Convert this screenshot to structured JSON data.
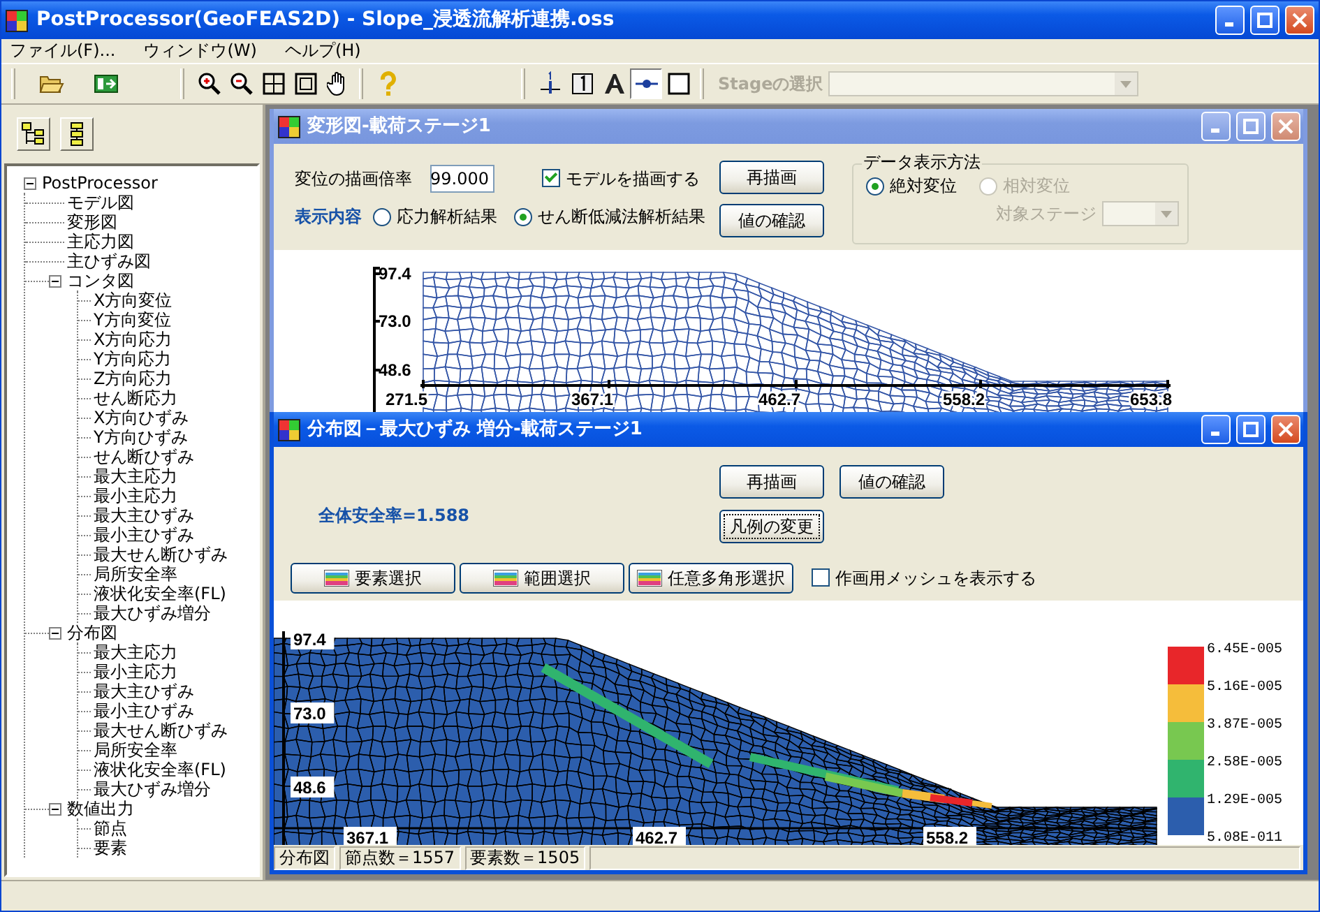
{
  "window": {
    "title": "PostProcessor(GeoFEAS2D) - Slope_浸透流解析連携.oss"
  },
  "menu": [
    "ファイル(F)...",
    "ウィンドウ(W)",
    "ヘルプ(H)"
  ],
  "toolbar": {
    "display_toggles": [
      {
        "pressed": false
      },
      {
        "pressed": false
      },
      {
        "pressed": false
      },
      {
        "pressed": true
      },
      {
        "pressed": false
      }
    ],
    "stage_select": {
      "label": "Stageの選択",
      "disabled": true
    }
  },
  "sidebar": {
    "tree": [
      {
        "label": "PostProcessor",
        "expanded": true,
        "children": [
          {
            "label": "モデル図"
          },
          {
            "label": "変形図"
          },
          {
            "label": "主応力図"
          },
          {
            "label": "主ひずみ図"
          },
          {
            "label": "コンタ図",
            "expanded": true,
            "children": [
              {
                "label": "X方向変位"
              },
              {
                "label": "Y方向変位"
              },
              {
                "label": "X方向応力"
              },
              {
                "label": "Y方向応力"
              },
              {
                "label": "Z方向応力"
              },
              {
                "label": "せん断応力"
              },
              {
                "label": "X方向ひずみ"
              },
              {
                "label": "Y方向ひずみ"
              },
              {
                "label": "せん断ひずみ"
              },
              {
                "label": "最大主応力"
              },
              {
                "label": "最小主応力"
              },
              {
                "label": "最大主ひずみ"
              },
              {
                "label": "最小主ひずみ"
              },
              {
                "label": "最大せん断ひずみ"
              },
              {
                "label": "局所安全率"
              },
              {
                "label": "液状化安全率(FL)"
              },
              {
                "label": "最大ひずみ増分"
              }
            ]
          },
          {
            "label": "分布図",
            "expanded": true,
            "children": [
              {
                "label": "最大主応力"
              },
              {
                "label": "最小主応力"
              },
              {
                "label": "最大主ひずみ"
              },
              {
                "label": "最小主ひずみ"
              },
              {
                "label": "最大せん断ひずみ"
              },
              {
                "label": "局所安全率"
              },
              {
                "label": "液状化安全率(FL)"
              },
              {
                "label": "最大ひずみ増分"
              }
            ]
          },
          {
            "label": "数値出力",
            "expanded": true,
            "children": [
              {
                "label": "節点"
              },
              {
                "label": "要素"
              }
            ]
          }
        ]
      }
    ]
  },
  "deformation_window": {
    "title": "変形図-載荷ステージ1",
    "active": false,
    "scale_label": "変位の描画倍率",
    "scale_value": "99.000",
    "draw_model": {
      "label": "モデルを描画する",
      "checked": true
    },
    "buttons": [
      "再描画",
      "値の確認"
    ],
    "display_label": "表示内容",
    "display_options": [
      {
        "label": "応力解析結果",
        "selected": false
      },
      {
        "label": "せん断低減法解析結果",
        "selected": true
      }
    ],
    "data_display": {
      "title": "データ表示方法",
      "options": [
        {
          "label": "絶対変位",
          "selected": true,
          "disabled": false
        },
        {
          "label": "相対変位",
          "selected": false,
          "disabled": true
        }
      ],
      "target_stage": {
        "label": "対象ステージ",
        "disabled": true
      }
    },
    "plot": {
      "y_ticks": [
        "97.4",
        "73.0",
        "48.6"
      ],
      "x_ticks": [
        "271.5",
        "367.1",
        "462.7",
        "558.2",
        "653.8"
      ]
    }
  },
  "distribution_window": {
    "title": "分布図－最大ひずみ 増分-載荷ステージ1",
    "active": true,
    "buttons": [
      {
        "label": "再描画",
        "focused": false
      },
      {
        "label": "値の確認",
        "focused": false
      },
      {
        "label": "凡例の変更",
        "focused": true
      }
    ],
    "safety_factor": "全体安全率=1.588",
    "select_buttons": [
      "要素選択",
      "範囲選択",
      "任意多角形選択"
    ],
    "show_mesh": {
      "label": "作画用メッシュを表示する",
      "checked": false
    },
    "plot": {
      "y_ticks": [
        "97.4",
        "73.0",
        "48.6"
      ],
      "x_ticks": [
        "367.1",
        "462.7",
        "558.2"
      ]
    },
    "legend": {
      "labels": [
        "6.45E-005",
        "5.16E-005",
        "3.87E-005",
        "2.58E-005",
        "1.29E-005",
        "5.08E-011"
      ],
      "bands": [
        {
          "color": "#e8262a"
        },
        {
          "color": "#f5bd3b"
        },
        {
          "color": "#78c850"
        },
        {
          "color": "#30b46e"
        },
        {
          "color": "#2c5ead"
        }
      ]
    },
    "status": [
      "分布図",
      "節点数＝1557",
      "要素数＝1505"
    ]
  }
}
